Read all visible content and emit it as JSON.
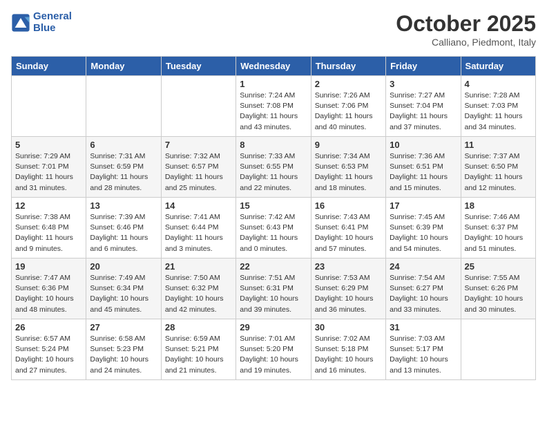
{
  "header": {
    "logo_line1": "General",
    "logo_line2": "Blue",
    "month": "October 2025",
    "location": "Calliano, Piedmont, Italy"
  },
  "days_of_week": [
    "Sunday",
    "Monday",
    "Tuesday",
    "Wednesday",
    "Thursday",
    "Friday",
    "Saturday"
  ],
  "weeks": [
    [
      {
        "day": "",
        "info": ""
      },
      {
        "day": "",
        "info": ""
      },
      {
        "day": "",
        "info": ""
      },
      {
        "day": "1",
        "info": "Sunrise: 7:24 AM\nSunset: 7:08 PM\nDaylight: 11 hours\nand 43 minutes."
      },
      {
        "day": "2",
        "info": "Sunrise: 7:26 AM\nSunset: 7:06 PM\nDaylight: 11 hours\nand 40 minutes."
      },
      {
        "day": "3",
        "info": "Sunrise: 7:27 AM\nSunset: 7:04 PM\nDaylight: 11 hours\nand 37 minutes."
      },
      {
        "day": "4",
        "info": "Sunrise: 7:28 AM\nSunset: 7:03 PM\nDaylight: 11 hours\nand 34 minutes."
      }
    ],
    [
      {
        "day": "5",
        "info": "Sunrise: 7:29 AM\nSunset: 7:01 PM\nDaylight: 11 hours\nand 31 minutes."
      },
      {
        "day": "6",
        "info": "Sunrise: 7:31 AM\nSunset: 6:59 PM\nDaylight: 11 hours\nand 28 minutes."
      },
      {
        "day": "7",
        "info": "Sunrise: 7:32 AM\nSunset: 6:57 PM\nDaylight: 11 hours\nand 25 minutes."
      },
      {
        "day": "8",
        "info": "Sunrise: 7:33 AM\nSunset: 6:55 PM\nDaylight: 11 hours\nand 22 minutes."
      },
      {
        "day": "9",
        "info": "Sunrise: 7:34 AM\nSunset: 6:53 PM\nDaylight: 11 hours\nand 18 minutes."
      },
      {
        "day": "10",
        "info": "Sunrise: 7:36 AM\nSunset: 6:51 PM\nDaylight: 11 hours\nand 15 minutes."
      },
      {
        "day": "11",
        "info": "Sunrise: 7:37 AM\nSunset: 6:50 PM\nDaylight: 11 hours\nand 12 minutes."
      }
    ],
    [
      {
        "day": "12",
        "info": "Sunrise: 7:38 AM\nSunset: 6:48 PM\nDaylight: 11 hours\nand 9 minutes."
      },
      {
        "day": "13",
        "info": "Sunrise: 7:39 AM\nSunset: 6:46 PM\nDaylight: 11 hours\nand 6 minutes."
      },
      {
        "day": "14",
        "info": "Sunrise: 7:41 AM\nSunset: 6:44 PM\nDaylight: 11 hours\nand 3 minutes."
      },
      {
        "day": "15",
        "info": "Sunrise: 7:42 AM\nSunset: 6:43 PM\nDaylight: 11 hours\nand 0 minutes."
      },
      {
        "day": "16",
        "info": "Sunrise: 7:43 AM\nSunset: 6:41 PM\nDaylight: 10 hours\nand 57 minutes."
      },
      {
        "day": "17",
        "info": "Sunrise: 7:45 AM\nSunset: 6:39 PM\nDaylight: 10 hours\nand 54 minutes."
      },
      {
        "day": "18",
        "info": "Sunrise: 7:46 AM\nSunset: 6:37 PM\nDaylight: 10 hours\nand 51 minutes."
      }
    ],
    [
      {
        "day": "19",
        "info": "Sunrise: 7:47 AM\nSunset: 6:36 PM\nDaylight: 10 hours\nand 48 minutes."
      },
      {
        "day": "20",
        "info": "Sunrise: 7:49 AM\nSunset: 6:34 PM\nDaylight: 10 hours\nand 45 minutes."
      },
      {
        "day": "21",
        "info": "Sunrise: 7:50 AM\nSunset: 6:32 PM\nDaylight: 10 hours\nand 42 minutes."
      },
      {
        "day": "22",
        "info": "Sunrise: 7:51 AM\nSunset: 6:31 PM\nDaylight: 10 hours\nand 39 minutes."
      },
      {
        "day": "23",
        "info": "Sunrise: 7:53 AM\nSunset: 6:29 PM\nDaylight: 10 hours\nand 36 minutes."
      },
      {
        "day": "24",
        "info": "Sunrise: 7:54 AM\nSunset: 6:27 PM\nDaylight: 10 hours\nand 33 minutes."
      },
      {
        "day": "25",
        "info": "Sunrise: 7:55 AM\nSunset: 6:26 PM\nDaylight: 10 hours\nand 30 minutes."
      }
    ],
    [
      {
        "day": "26",
        "info": "Sunrise: 6:57 AM\nSunset: 5:24 PM\nDaylight: 10 hours\nand 27 minutes."
      },
      {
        "day": "27",
        "info": "Sunrise: 6:58 AM\nSunset: 5:23 PM\nDaylight: 10 hours\nand 24 minutes."
      },
      {
        "day": "28",
        "info": "Sunrise: 6:59 AM\nSunset: 5:21 PM\nDaylight: 10 hours\nand 21 minutes."
      },
      {
        "day": "29",
        "info": "Sunrise: 7:01 AM\nSunset: 5:20 PM\nDaylight: 10 hours\nand 19 minutes."
      },
      {
        "day": "30",
        "info": "Sunrise: 7:02 AM\nSunset: 5:18 PM\nDaylight: 10 hours\nand 16 minutes."
      },
      {
        "day": "31",
        "info": "Sunrise: 7:03 AM\nSunset: 5:17 PM\nDaylight: 10 hours\nand 13 minutes."
      },
      {
        "day": "",
        "info": ""
      }
    ]
  ]
}
